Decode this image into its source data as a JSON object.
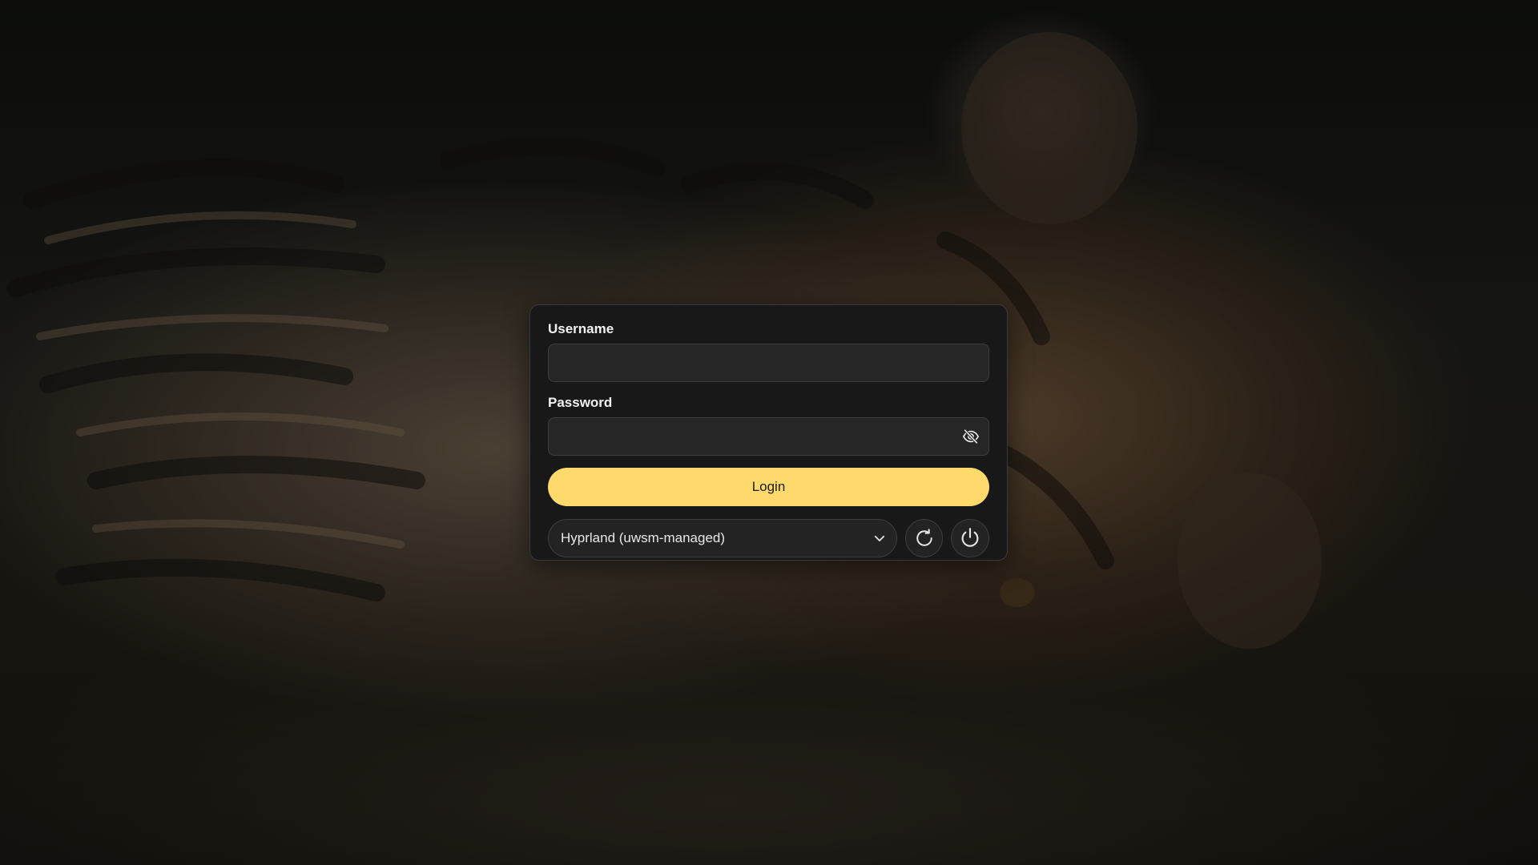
{
  "login_form": {
    "username_label": "Username",
    "username_value": "",
    "password_label": "Password",
    "password_value": "",
    "password_toggle_icon": "eye-off-icon",
    "login_label": "Login"
  },
  "session": {
    "selected": "Hyprland (uwsm-managed)",
    "dropdown_icon": "chevron-down-icon"
  },
  "actions": {
    "reboot_icon": "reboot-icon",
    "power_icon": "power-icon"
  },
  "colors": {
    "accent": "#fdda6b",
    "card_background": "#181818",
    "input_background": "#262626",
    "text": "#f2f2f2"
  }
}
